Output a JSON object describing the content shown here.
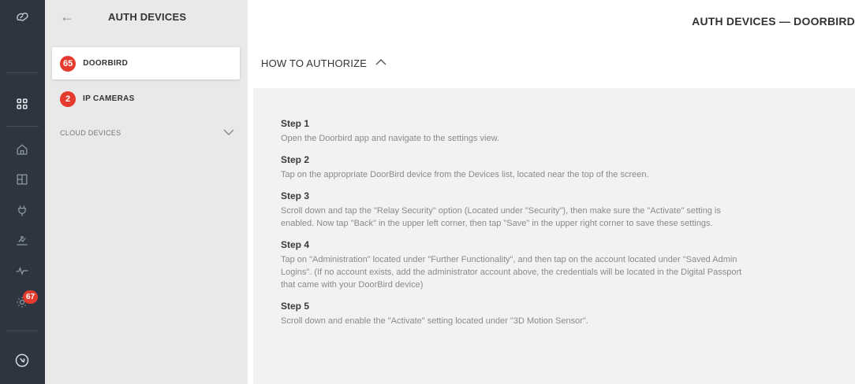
{
  "rail": {
    "badge_count": "67",
    "icons": [
      "logo-icon",
      "grid-icon",
      "home-icon",
      "floorplan-icon",
      "plug-icon",
      "scene-icon",
      "activity-icon",
      "settings-icon",
      "tools-icon"
    ]
  },
  "sidebar": {
    "title": "AUTH DEVICES",
    "items": [
      {
        "count": "65",
        "label": "DOORBIRD",
        "active": true
      },
      {
        "count": "2",
        "label": "IP CAMERAS",
        "active": false
      }
    ],
    "group_label": "CLOUD DEVICES"
  },
  "main": {
    "page_title": "AUTH DEVICES — DOORBIRD",
    "section_title": "HOW TO AUTHORIZE",
    "steps": [
      {
        "title": "Step 1",
        "text": "Open the Doorbird app and navigate to the settings view."
      },
      {
        "title": "Step 2",
        "text": "Tap on the appropriate DoorBird device from the Devices list, located near the top of the screen."
      },
      {
        "title": "Step 3",
        "text": "Scroll down and tap the \"Relay Security\" option (Located under \"Security\"), then make sure the \"Activate\" setting is enabled. Now tap \"Back\" in the upper left corner, then tap \"Save\" in the upper right corner to save these settings."
      },
      {
        "title": "Step 4",
        "text": "Tap on \"Administration\" located under \"Further Functionality\", and then tap on the account located under \"Saved Admin Logins\". (If no account exists, add the administrator account above, the credentials will be located in the Digital Passport that came with your DoorBird device)"
      },
      {
        "title": "Step 5",
        "text": "Scroll down and enable the \"Activate\" setting located under \"3D Motion Sensor\"."
      }
    ]
  },
  "colors": {
    "rail_bg": "#2d3640",
    "sidebar_bg": "#e9e9e9",
    "badge": "#e53b2f",
    "panel_bg": "#f2f2f2"
  }
}
